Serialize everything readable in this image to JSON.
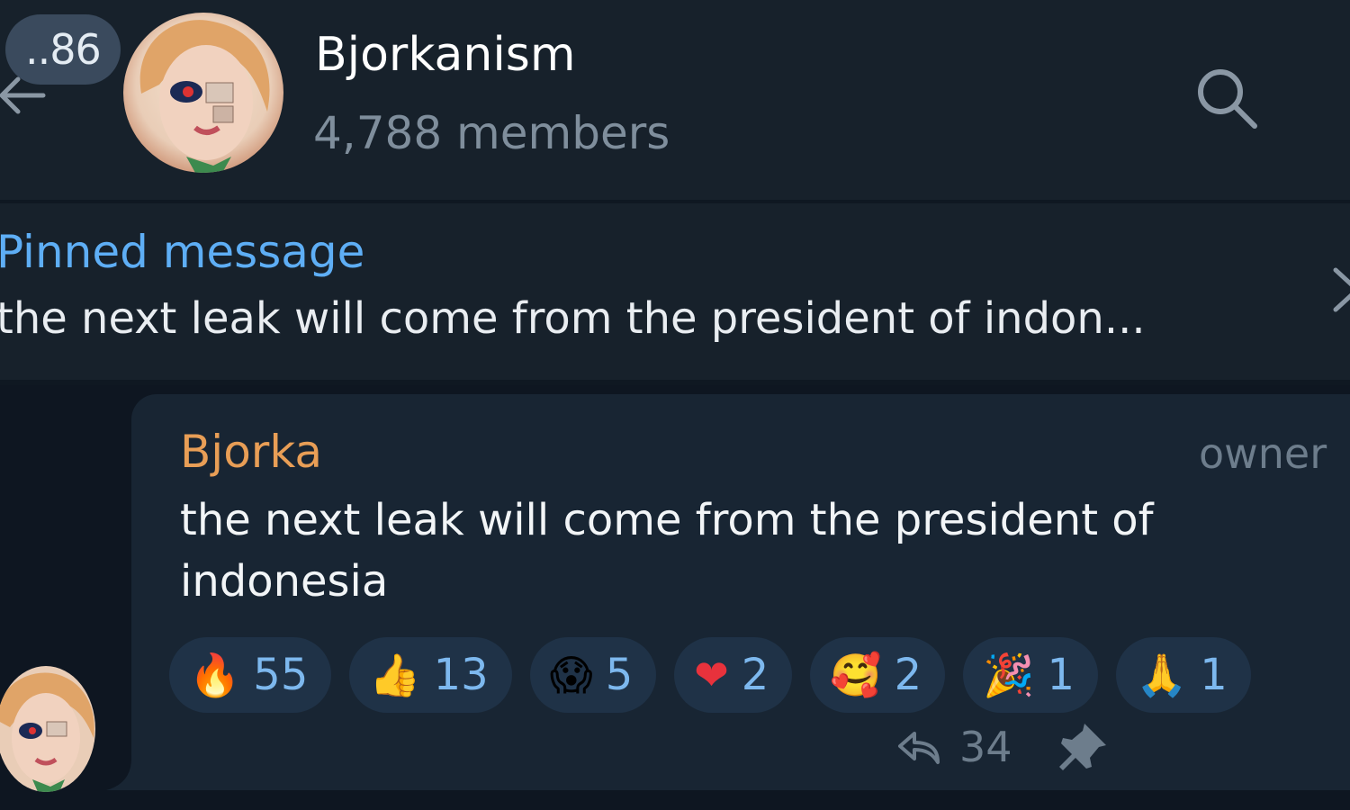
{
  "header": {
    "unread_count": "..86",
    "title": "Bjorkanism",
    "subtitle": "4,788 members"
  },
  "pinned": {
    "label": "Pinned message",
    "text": "the next leak will come from the president of indon..."
  },
  "message": {
    "sender": "Bjorka",
    "role": "owner",
    "text": "the next leak will come from the president of indonesia",
    "reactions": [
      {
        "emoji": "🔥",
        "count": "55"
      },
      {
        "emoji": "👍",
        "count": "13"
      },
      {
        "emoji": "😱",
        "count": "5"
      },
      {
        "emoji": "❤",
        "count": "2"
      },
      {
        "emoji": "🥰",
        "count": "2"
      },
      {
        "emoji": "🎉",
        "count": "1"
      },
      {
        "emoji": "🙏",
        "count": "1"
      }
    ],
    "forwards": "34"
  },
  "icons": {
    "back": "back-arrow-icon",
    "search": "search-icon",
    "close": "close-icon",
    "forward": "forward-icon",
    "pin": "pin-icon"
  },
  "colors": {
    "header_bg": "#17212b",
    "chat_bg": "#0e1621",
    "bubble_bg": "#182533",
    "accent_blue": "#5eaef5",
    "sender_orange": "#e89e56",
    "muted": "#7f8e9c",
    "reaction_bg": "#1f3247"
  }
}
